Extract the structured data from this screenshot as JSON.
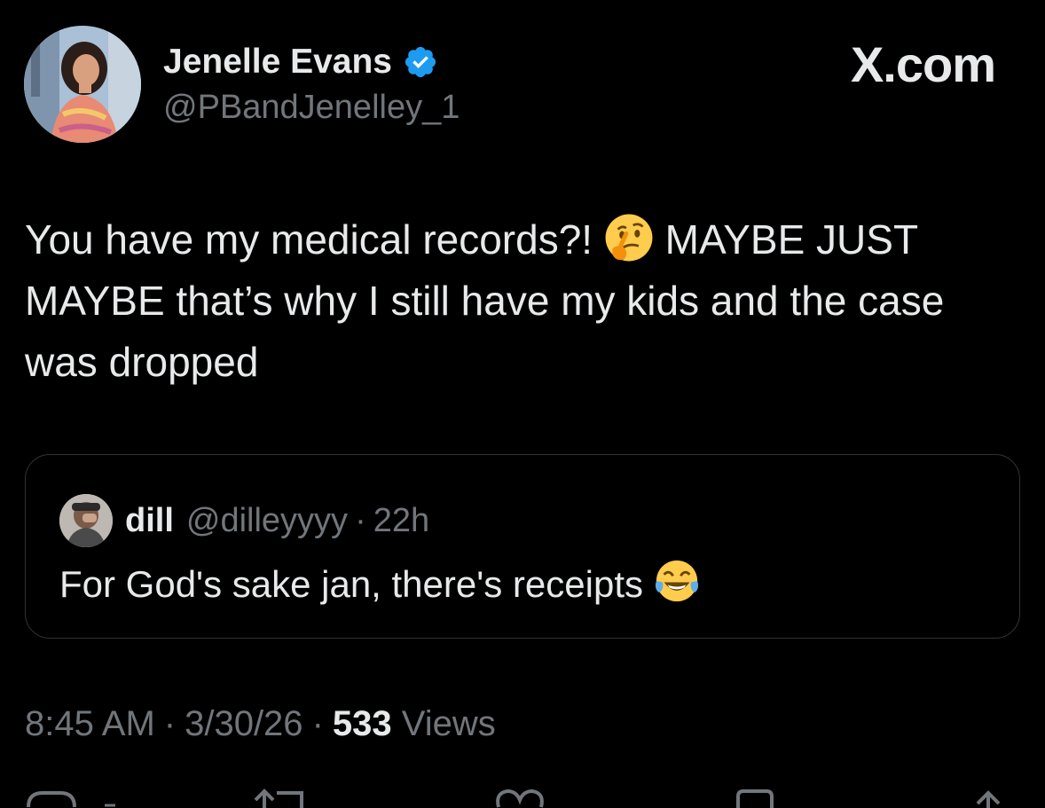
{
  "author": {
    "name": "Jenelle Evans",
    "handle": "@PBandJenelley_1",
    "verified": true,
    "verified_color": "#1d9bf0"
  },
  "brand": {
    "logo_text": "X.com"
  },
  "tweet": {
    "text_part1": "You have my medical records?! ",
    "emoji1": "thinking-face-emoji",
    "text_part2": " MAYBE JUST MAYBE that’s why I still have my kids and the case was dropped"
  },
  "quote": {
    "name": "dill",
    "handle": "@dilleyyyy",
    "dot": "·",
    "time": "22h",
    "text": "For God's sake jan, there's receipts ",
    "emoji": "tears-of-joy-emoji"
  },
  "meta": {
    "time": "8:45 AM",
    "sep1": "·",
    "date": "3/30/26",
    "sep2": "·",
    "views_count": "533",
    "views_label": "Views"
  },
  "actions": [
    {
      "icon": "reply-icon"
    },
    {
      "icon": "repost-icon"
    },
    {
      "icon": "like-icon"
    },
    {
      "icon": "bookmark-icon"
    },
    {
      "icon": "share-icon"
    }
  ],
  "colors": {
    "background": "#000000",
    "text": "#e7e9ea",
    "secondary": "#71767b",
    "border": "#2f3336"
  }
}
